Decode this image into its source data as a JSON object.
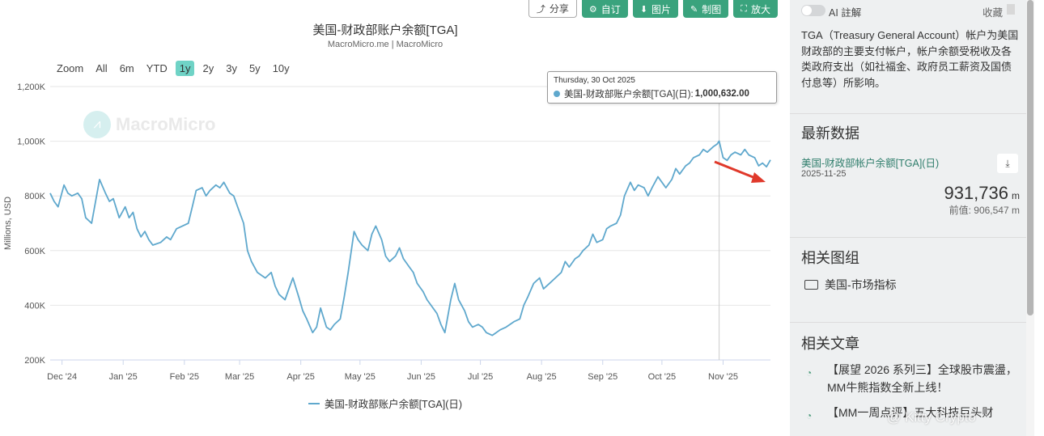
{
  "toolbar": {
    "share": "分享",
    "custom": "自订",
    "image": "图片",
    "draw": "制图",
    "enlarge": "放大"
  },
  "chart_data": {
    "type": "line",
    "title": "美国-财政部账户余额[TGA]",
    "subtitle": "MacroMicro.me | MacroMicro",
    "ylabel": "Millions, USD",
    "ylim": [
      200000,
      1200000
    ],
    "yticks": [
      200000,
      400000,
      600000,
      800000,
      1000000,
      1200000
    ],
    "ytick_labels": [
      "200K",
      "400K",
      "600K",
      "800K",
      "1,000K",
      "1,200K"
    ],
    "xticks": [
      "2024-12-01",
      "2025-01-01",
      "2025-02-01",
      "2025-03-01",
      "2025-04-01",
      "2025-05-01",
      "2025-06-01",
      "2025-07-01",
      "2025-08-01",
      "2025-09-01",
      "2025-10-01",
      "2025-11-01"
    ],
    "xtick_labels": [
      "Dec '24",
      "Jan '25",
      "Feb '25",
      "Mar '25",
      "Apr '25",
      "May '25",
      "Jun '25",
      "Jul '25",
      "Aug '25",
      "Sep '25",
      "Oct '25",
      "Nov '25"
    ],
    "xlim": [
      "2024-11-25",
      "2025-11-25"
    ],
    "grid": true,
    "legend": "bottom",
    "series": [
      {
        "name": "美国-财政部账户余额[TGA](日)",
        "color": "#5fa8cd",
        "points": [
          [
            "2024-11-25",
            810000
          ],
          [
            "2024-11-27",
            780000
          ],
          [
            "2024-11-29",
            760000
          ],
          [
            "2024-12-02",
            840000
          ],
          [
            "2024-12-04",
            810000
          ],
          [
            "2024-12-06",
            800000
          ],
          [
            "2024-12-09",
            810000
          ],
          [
            "2024-12-11",
            790000
          ],
          [
            "2024-12-13",
            720000
          ],
          [
            "2024-12-16",
            700000
          ],
          [
            "2024-12-18",
            780000
          ],
          [
            "2024-12-20",
            860000
          ],
          [
            "2024-12-23",
            810000
          ],
          [
            "2024-12-25",
            780000
          ],
          [
            "2024-12-27",
            790000
          ],
          [
            "2024-12-30",
            720000
          ],
          [
            "2025-01-02",
            760000
          ],
          [
            "2025-01-04",
            720000
          ],
          [
            "2025-01-06",
            740000
          ],
          [
            "2025-01-08",
            680000
          ],
          [
            "2025-01-10",
            650000
          ],
          [
            "2025-01-12",
            670000
          ],
          [
            "2025-01-14",
            640000
          ],
          [
            "2025-01-16",
            620000
          ],
          [
            "2025-01-20",
            630000
          ],
          [
            "2025-01-23",
            650000
          ],
          [
            "2025-01-25",
            640000
          ],
          [
            "2025-01-28",
            680000
          ],
          [
            "2025-01-31",
            690000
          ],
          [
            "2025-02-03",
            700000
          ],
          [
            "2025-02-05",
            760000
          ],
          [
            "2025-02-07",
            820000
          ],
          [
            "2025-02-10",
            830000
          ],
          [
            "2025-02-12",
            800000
          ],
          [
            "2025-02-14",
            820000
          ],
          [
            "2025-02-17",
            840000
          ],
          [
            "2025-02-19",
            830000
          ],
          [
            "2025-02-21",
            850000
          ],
          [
            "2025-02-24",
            810000
          ],
          [
            "2025-02-26",
            800000
          ],
          [
            "2025-02-28",
            760000
          ],
          [
            "2025-03-03",
            700000
          ],
          [
            "2025-03-05",
            600000
          ],
          [
            "2025-03-07",
            560000
          ],
          [
            "2025-03-10",
            520000
          ],
          [
            "2025-03-12",
            510000
          ],
          [
            "2025-03-14",
            500000
          ],
          [
            "2025-03-17",
            520000
          ],
          [
            "2025-03-19",
            470000
          ],
          [
            "2025-03-21",
            440000
          ],
          [
            "2025-03-24",
            420000
          ],
          [
            "2025-03-26",
            460000
          ],
          [
            "2025-03-28",
            500000
          ],
          [
            "2025-03-31",
            430000
          ],
          [
            "2025-04-02",
            380000
          ],
          [
            "2025-04-04",
            350000
          ],
          [
            "2025-04-07",
            300000
          ],
          [
            "2025-04-09",
            320000
          ],
          [
            "2025-04-11",
            390000
          ],
          [
            "2025-04-14",
            320000
          ],
          [
            "2025-04-16",
            310000
          ],
          [
            "2025-04-18",
            330000
          ],
          [
            "2025-04-21",
            350000
          ],
          [
            "2025-04-23",
            430000
          ],
          [
            "2025-04-25",
            520000
          ],
          [
            "2025-04-28",
            670000
          ],
          [
            "2025-04-30",
            640000
          ],
          [
            "2025-05-02",
            620000
          ],
          [
            "2025-05-05",
            600000
          ],
          [
            "2025-05-07",
            660000
          ],
          [
            "2025-05-09",
            690000
          ],
          [
            "2025-05-12",
            640000
          ],
          [
            "2025-05-14",
            580000
          ],
          [
            "2025-05-16",
            560000
          ],
          [
            "2025-05-19",
            580000
          ],
          [
            "2025-05-21",
            610000
          ],
          [
            "2025-05-23",
            570000
          ],
          [
            "2025-05-26",
            540000
          ],
          [
            "2025-05-28",
            520000
          ],
          [
            "2025-05-30",
            480000
          ],
          [
            "2025-06-02",
            450000
          ],
          [
            "2025-06-04",
            420000
          ],
          [
            "2025-06-06",
            400000
          ],
          [
            "2025-06-09",
            370000
          ],
          [
            "2025-06-11",
            330000
          ],
          [
            "2025-06-13",
            300000
          ],
          [
            "2025-06-16",
            420000
          ],
          [
            "2025-06-18",
            480000
          ],
          [
            "2025-06-20",
            420000
          ],
          [
            "2025-06-23",
            380000
          ],
          [
            "2025-06-25",
            340000
          ],
          [
            "2025-06-27",
            320000
          ],
          [
            "2025-06-30",
            330000
          ],
          [
            "2025-07-02",
            320000
          ],
          [
            "2025-07-04",
            300000
          ],
          [
            "2025-07-07",
            290000
          ],
          [
            "2025-07-09",
            300000
          ],
          [
            "2025-07-11",
            310000
          ],
          [
            "2025-07-14",
            320000
          ],
          [
            "2025-07-16",
            330000
          ],
          [
            "2025-07-18",
            340000
          ],
          [
            "2025-07-21",
            350000
          ],
          [
            "2025-07-23",
            400000
          ],
          [
            "2025-07-25",
            430000
          ],
          [
            "2025-07-28",
            480000
          ],
          [
            "2025-07-31",
            500000
          ],
          [
            "2025-08-02",
            460000
          ],
          [
            "2025-08-05",
            480000
          ],
          [
            "2025-08-08",
            500000
          ],
          [
            "2025-08-11",
            520000
          ],
          [
            "2025-08-13",
            560000
          ],
          [
            "2025-08-15",
            540000
          ],
          [
            "2025-08-18",
            570000
          ],
          [
            "2025-08-20",
            580000
          ],
          [
            "2025-08-22",
            600000
          ],
          [
            "2025-08-25",
            620000
          ],
          [
            "2025-08-27",
            660000
          ],
          [
            "2025-08-29",
            630000
          ],
          [
            "2025-09-01",
            640000
          ],
          [
            "2025-09-03",
            680000
          ],
          [
            "2025-09-05",
            690000
          ],
          [
            "2025-09-08",
            700000
          ],
          [
            "2025-09-10",
            730000
          ],
          [
            "2025-09-12",
            800000
          ],
          [
            "2025-09-15",
            850000
          ],
          [
            "2025-09-17",
            820000
          ],
          [
            "2025-09-19",
            840000
          ],
          [
            "2025-09-22",
            830000
          ],
          [
            "2025-09-24",
            800000
          ],
          [
            "2025-09-26",
            830000
          ],
          [
            "2025-09-29",
            870000
          ],
          [
            "2025-10-01",
            850000
          ],
          [
            "2025-10-03",
            830000
          ],
          [
            "2025-10-06",
            860000
          ],
          [
            "2025-10-08",
            900000
          ],
          [
            "2025-10-10",
            880000
          ],
          [
            "2025-10-13",
            910000
          ],
          [
            "2025-10-15",
            920000
          ],
          [
            "2025-10-17",
            940000
          ],
          [
            "2025-10-20",
            950000
          ],
          [
            "2025-10-22",
            970000
          ],
          [
            "2025-10-24",
            960000
          ],
          [
            "2025-10-27",
            980000
          ],
          [
            "2025-10-29",
            990000
          ],
          [
            "2025-10-30",
            1000632
          ],
          [
            "2025-11-01",
            940000
          ],
          [
            "2025-11-03",
            930000
          ],
          [
            "2025-11-05",
            950000
          ],
          [
            "2025-11-07",
            960000
          ],
          [
            "2025-11-10",
            950000
          ],
          [
            "2025-11-12",
            970000
          ],
          [
            "2025-11-14",
            950000
          ],
          [
            "2025-11-17",
            940000
          ],
          [
            "2025-11-19",
            910000
          ],
          [
            "2025-11-21",
            920000
          ],
          [
            "2025-11-23",
            906547
          ],
          [
            "2025-11-25",
            931736
          ]
        ]
      }
    ]
  },
  "zoom": {
    "label": "Zoom",
    "buttons": [
      "All",
      "6m",
      "YTD",
      "1y",
      "2y",
      "3y",
      "5y",
      "10y"
    ],
    "active": "1y"
  },
  "tooltip": {
    "date": "Thursday, 30 Oct 2025",
    "series": "美国-财政部账户余额[TGA](日):",
    "value": "1,000,632.00"
  },
  "legend": {
    "label": "美国-财政部账户余额[TGA](日)"
  },
  "watermark": "MacroMicro",
  "sidebar": {
    "ai_label": "AI 註解",
    "fav_label": "收藏",
    "description": "TGA（Treasury General Account）帐户为美国财政部的主要支付帐户，帐户余额受税收及各类政府支出（如社福金、政府员工薪资及国债付息等）所影响。",
    "latest_title": "最新数据",
    "latest_name": "美国-财政部帐户余额[TGA](日)",
    "latest_date": "2025-11-25",
    "latest_value": "931,736",
    "latest_unit": "m",
    "prev_value": "前值: 906,547 m",
    "group_title": "相关图组",
    "group_item": "美国-市场指标",
    "articles_title": "相关文章",
    "articles": [
      "【展望 2026 系列三】全球股市震盪，MM牛熊指数全新上线！",
      "【MM一周点评】五大科技巨头财"
    ]
  },
  "site_watermark": "@ Kitty Crypto"
}
